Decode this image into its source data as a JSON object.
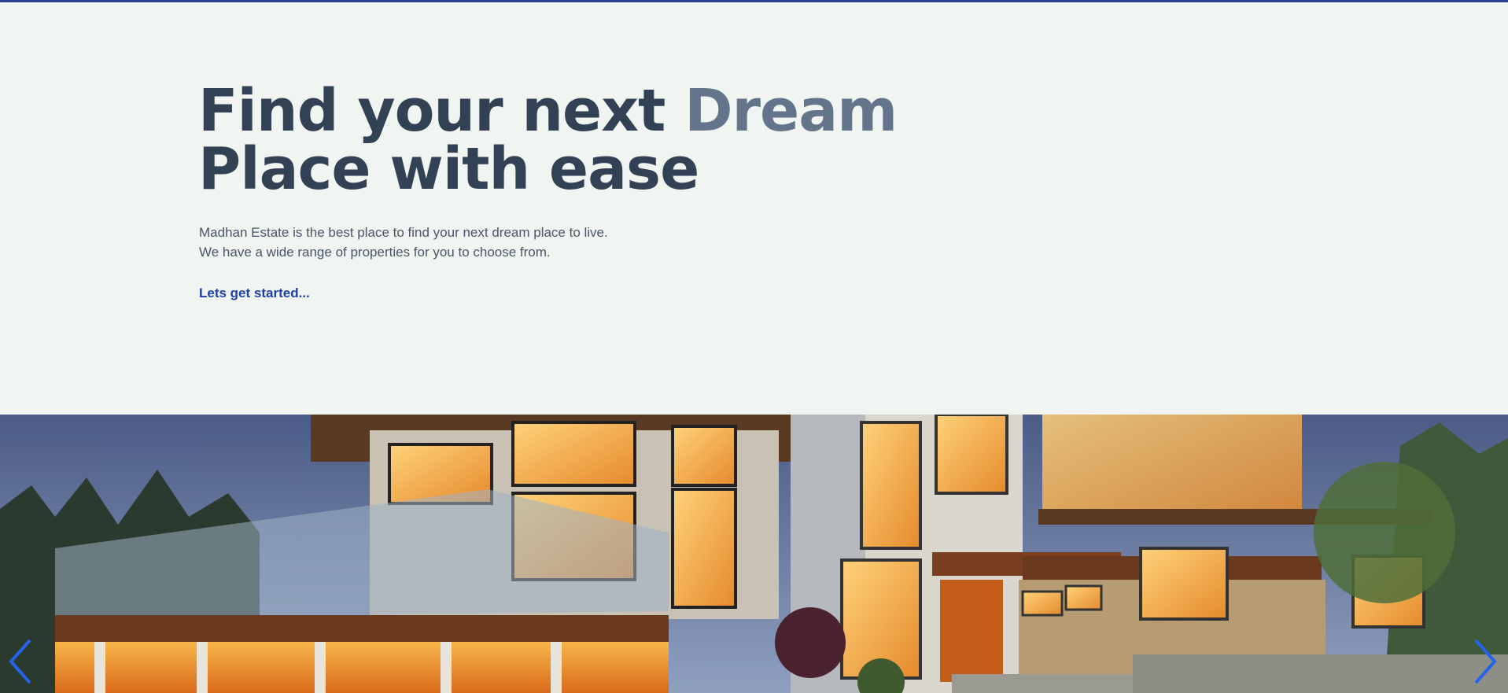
{
  "hero": {
    "headline_part1": "Find your next ",
    "headline_accent": "Dream",
    "headline_part2": "Place with ease",
    "description_line1": "Madhan Estate is the best place to find your next dream place to live.",
    "description_line2": "We have a wide range of properties for you to choose from.",
    "cta_label": "Lets get started..."
  },
  "slider": {
    "image_subject": "modern house exterior at dusk",
    "prev_icon": "chevron-left-icon",
    "next_icon": "chevron-right-icon"
  },
  "colors": {
    "top_bar": "#2a3f8f",
    "background": "#f1f5f1",
    "headline": "#334155",
    "headline_accent": "#64748b",
    "cta": "#1e40af",
    "slider_arrow": "#2563eb"
  }
}
